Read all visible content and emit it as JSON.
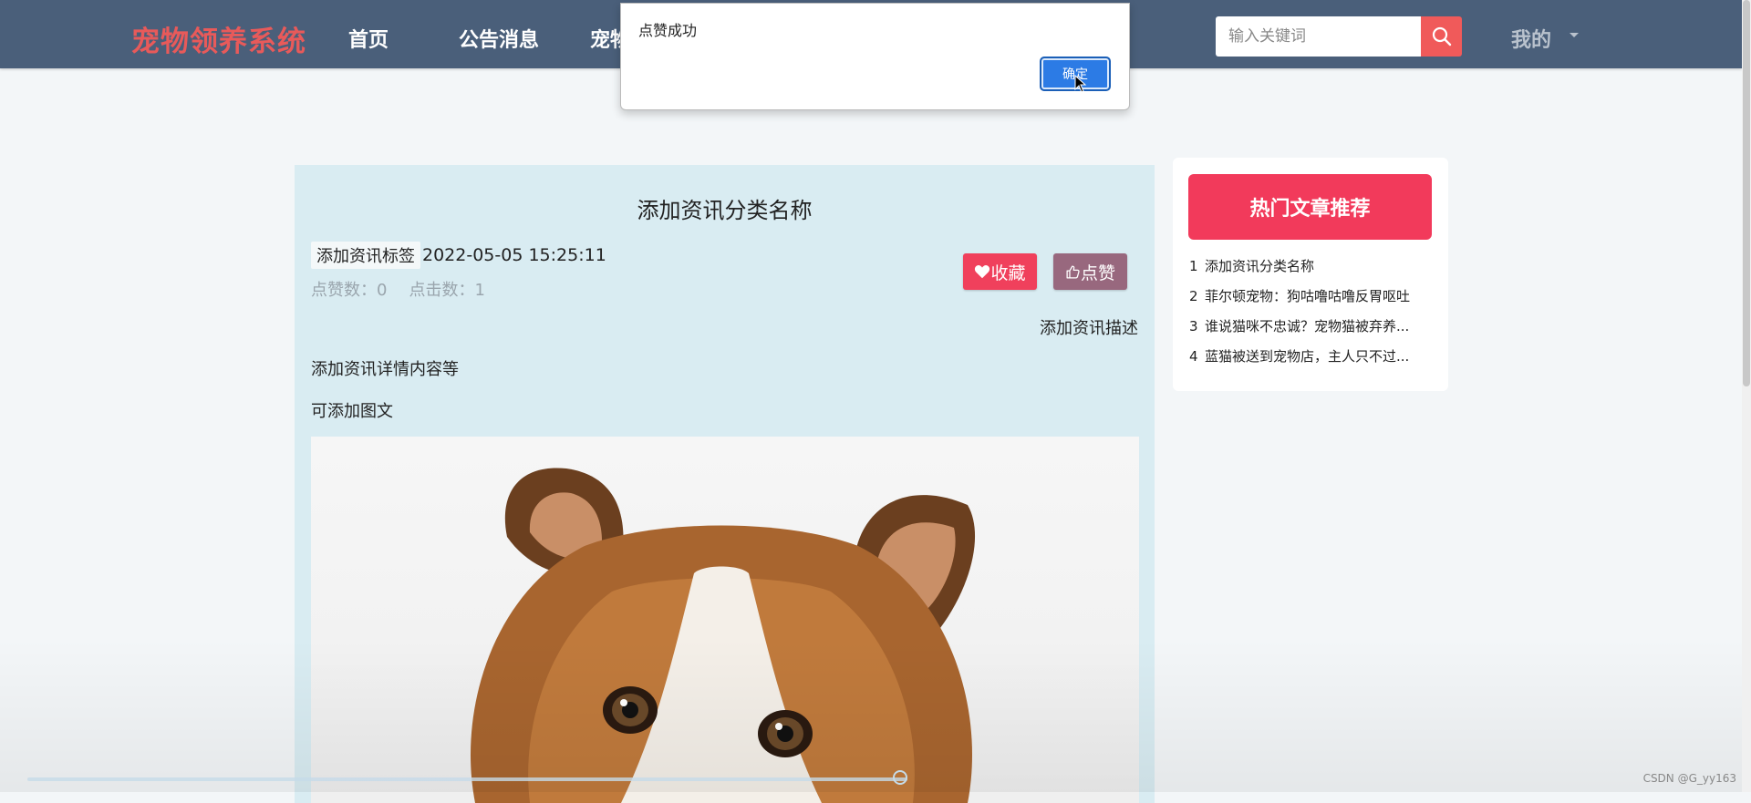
{
  "header": {
    "brand": "宠物领养系统",
    "nav": [
      "首页",
      "公告消息",
      "宠物"
    ],
    "search_placeholder": "输入关键词",
    "me": "我的"
  },
  "alert": {
    "message": "点赞成功",
    "ok_label": "确定"
  },
  "article": {
    "title": "添加资讯分类名称",
    "tag": "添加资讯标签",
    "date": "2022-05-05 15:25:11",
    "likes_label": "点赞数：0",
    "clicks_label": "点击数：1",
    "fav_label": "收藏",
    "like_label": "点赞",
    "description": "添加资讯描述",
    "content": [
      "添加资讯详情内容等",
      "可添加图文"
    ]
  },
  "sidebar": {
    "title": "热门文章推荐",
    "items": [
      {
        "num": "1",
        "text": "添加资讯分类名称"
      },
      {
        "num": "2",
        "text": "菲尔顿宠物：狗咕噜咕噜反胃呕吐"
      },
      {
        "num": "3",
        "text": "谁说猫咪不忠诚？宠物猫被弃养..."
      },
      {
        "num": "4",
        "text": "蓝猫被送到宠物店，主人只不过..."
      }
    ]
  },
  "watermark": "CSDN @G_yy163",
  "colors": {
    "navbar": "#4a5f7a",
    "brand": "#e85a5a",
    "accent_red": "#f0405c",
    "like_button": "#98687e",
    "article_bg": "#d9ecf2"
  }
}
